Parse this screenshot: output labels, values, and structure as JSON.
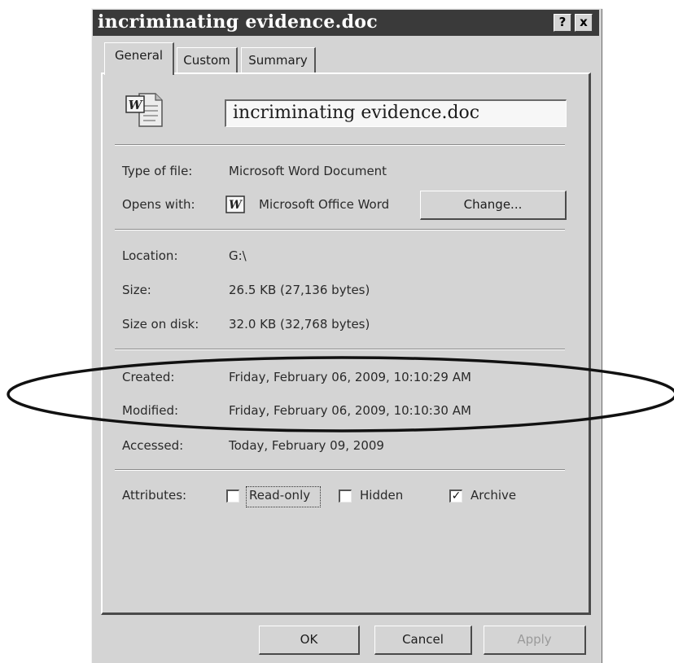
{
  "window": {
    "title": "incriminating evidence.doc",
    "help_label": "?",
    "close_label": "x"
  },
  "tabs": [
    {
      "label": "General",
      "active": true
    },
    {
      "label": "Custom",
      "active": false
    },
    {
      "label": "Summary",
      "active": false
    }
  ],
  "file": {
    "name": "incriminating evidence.doc",
    "icon": "word-document-icon"
  },
  "info": {
    "type_label": "Type of file:",
    "type_value": "Microsoft Word Document",
    "opens_label": "Opens with:",
    "opens_value": "Microsoft Office Word",
    "change_button": "Change...",
    "location_label": "Location:",
    "location_value": "G:\\",
    "size_label": "Size:",
    "size_value": "26.5 KB (27,136 bytes)",
    "size_disk_label": "Size on disk:",
    "size_disk_value": "32.0 KB (32,768 bytes)",
    "created_label": "Created:",
    "created_value": "Friday, February 06, 2009, 10:10:29 AM",
    "modified_label": "Modified:",
    "modified_value": "Friday, February 06, 2009, 10:10:30 AM",
    "accessed_label": "Accessed:",
    "accessed_value": "Today, February 09, 2009"
  },
  "attributes": {
    "label": "Attributes:",
    "readonly": {
      "label": "Read-only",
      "checked": false
    },
    "hidden": {
      "label": "Hidden",
      "checked": false
    },
    "archive": {
      "label": "Archive",
      "checked": true
    }
  },
  "buttons": {
    "ok": "OK",
    "cancel": "Cancel",
    "apply": "Apply"
  },
  "annotation": {
    "shape": "ellipse",
    "highlights": "Created and Modified dates"
  }
}
